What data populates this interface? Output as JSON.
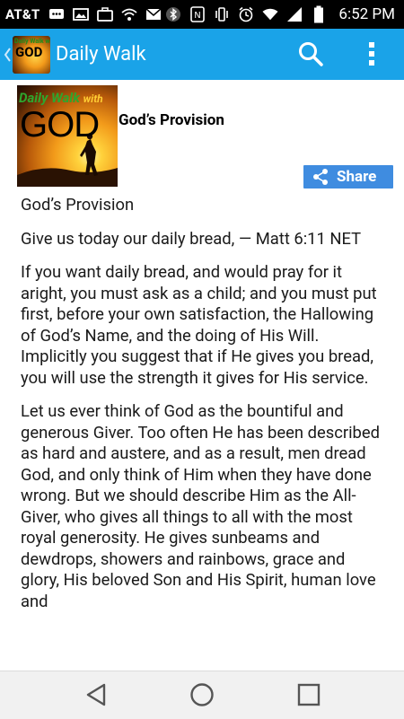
{
  "status_bar": {
    "carrier": "AT&T",
    "time": "6:52 PM"
  },
  "action_bar": {
    "title": "Daily Walk",
    "logo_text_top": "Daily Walk with",
    "logo_text_main": "GOD"
  },
  "entry": {
    "image_text_top": "Daily Walk",
    "image_text_with": "with",
    "image_text_main": "GOD",
    "title": "God’s Provision",
    "share_label": "Share"
  },
  "body": {
    "paragraphs": [
      "God’s Provision",
      "Give us today our daily bread, — Matt 6:11 NET",
      "If you want daily bread, and would pray for it aright, you must ask as a child; and you must put first, before your own satisfaction, the Hallowing of God’s Name, and the doing of His Will. Implicitly you suggest that if He gives you bread, you will use the strength it gives for His service.",
      "Let us ever think of God as the bountiful and generous Giver. Too often He has been described as hard and austere, and as a result, men dread God, and only think of Him when they have done wrong. But we should describe Him as the All-Giver, who gives all things to all with the most royal generosity. He gives sunbeams and dewdrops, showers and rainbows, grace and glory, His beloved Son and His Spirit, human love and"
    ]
  },
  "colors": {
    "action_bar": "#1aa3e8",
    "share_button": "#3f8ce0",
    "status_bar": "#000000",
    "nav_bar": "#f1f1f1"
  },
  "icons": {
    "back": "chevron-left-icon",
    "search": "search-icon",
    "overflow": "more-vert-icon",
    "share": "share-icon",
    "nav_back": "triangle-back-icon",
    "nav_home": "circle-home-icon",
    "nav_recents": "square-recents-icon"
  }
}
